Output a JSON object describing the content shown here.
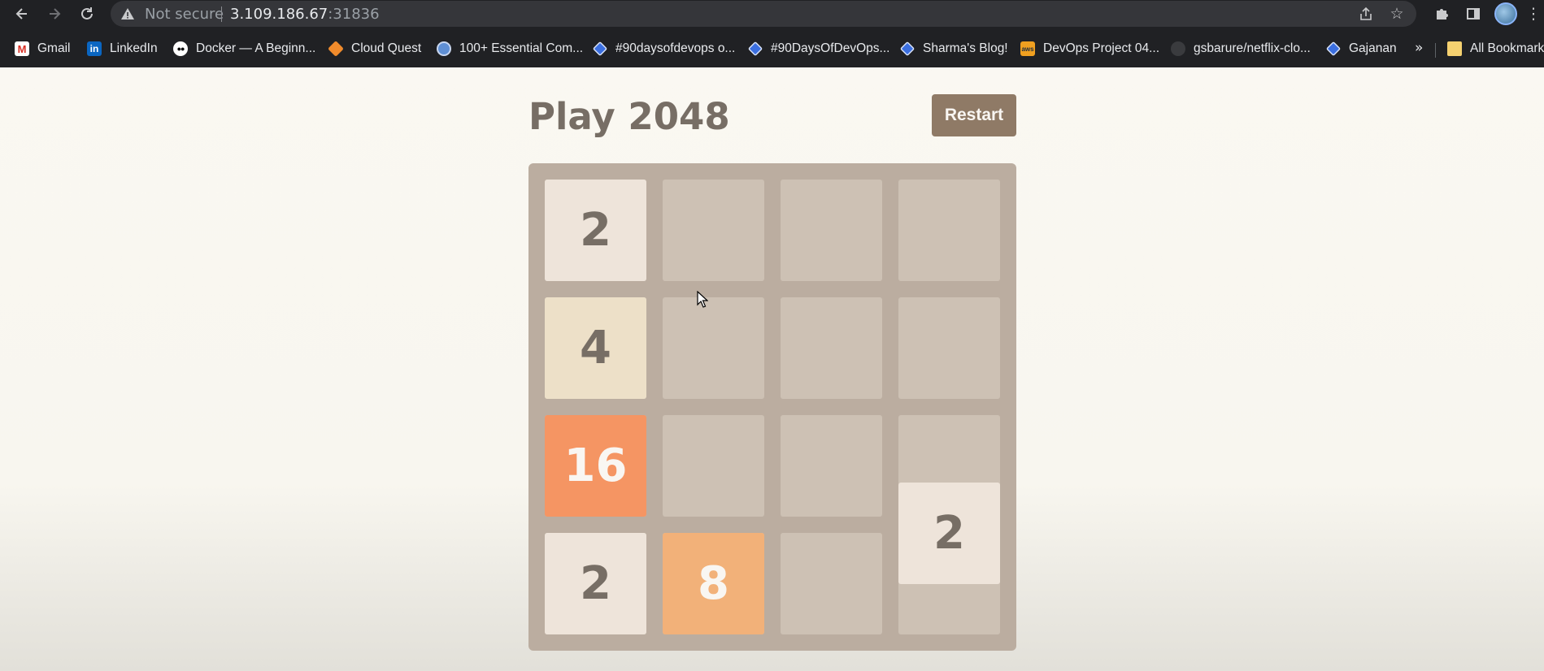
{
  "browser": {
    "address": {
      "security_label": "Not secure",
      "host": "3.109.186.67",
      "port": ":31836"
    },
    "icons": {
      "back": "back-arrow-icon",
      "forward": "forward-arrow-icon",
      "reload": "reload-icon",
      "warning": "warning-triangle-icon",
      "share": "share-icon",
      "bookmark_star": "star-icon",
      "extensions": "puzzle-icon",
      "side_panel": "side-panel-icon",
      "menu": "kebab-menu-icon"
    },
    "bookmarks": [
      {
        "label": "Gmail",
        "icon": "gmail-icon"
      },
      {
        "label": "LinkedIn",
        "icon": "linkedin-icon"
      },
      {
        "label": "Docker — A Beginn...",
        "icon": "medium-icon"
      },
      {
        "label": "Cloud Quest",
        "icon": "cube-icon"
      },
      {
        "label": "100+ Essential Com...",
        "icon": "circle-icon"
      },
      {
        "label": "#90daysofdevops o...",
        "icon": "diamond-icon"
      },
      {
        "label": "#90DaysOfDevOps...",
        "icon": "diamond-icon"
      },
      {
        "label": "Sharma's Blog!",
        "icon": "diamond-icon"
      },
      {
        "label": "DevOps Project 04...",
        "icon": "aws-icon"
      },
      {
        "label": "gsbarure/netflix-clo...",
        "icon": "github-icon"
      },
      {
        "label": "Gajanan",
        "icon": "diamond-icon"
      }
    ],
    "bookmarks_more": "»",
    "all_bookmarks": "All Bookmarks"
  },
  "game": {
    "title": "Play 2048",
    "restart_label": "Restart",
    "tiles": [
      {
        "row": 0,
        "col": 0,
        "value": "2"
      },
      {
        "row": 1,
        "col": 0,
        "value": "4"
      },
      {
        "row": 2,
        "col": 0,
        "value": "16"
      },
      {
        "row": 3,
        "col": 0,
        "value": "2"
      },
      {
        "row": 3,
        "col": 1,
        "value": "8"
      },
      {
        "row": 3,
        "col": 3,
        "value": "2",
        "sliding": true
      }
    ],
    "colors": {
      "board": "#bbada0",
      "empty_cell": "#cdc1b4",
      "tile_2": "#eee4da",
      "tile_4": "#ede0c8",
      "tile_8": "#f2b179",
      "tile_16": "#f59563",
      "button": "#8f7a66"
    }
  }
}
